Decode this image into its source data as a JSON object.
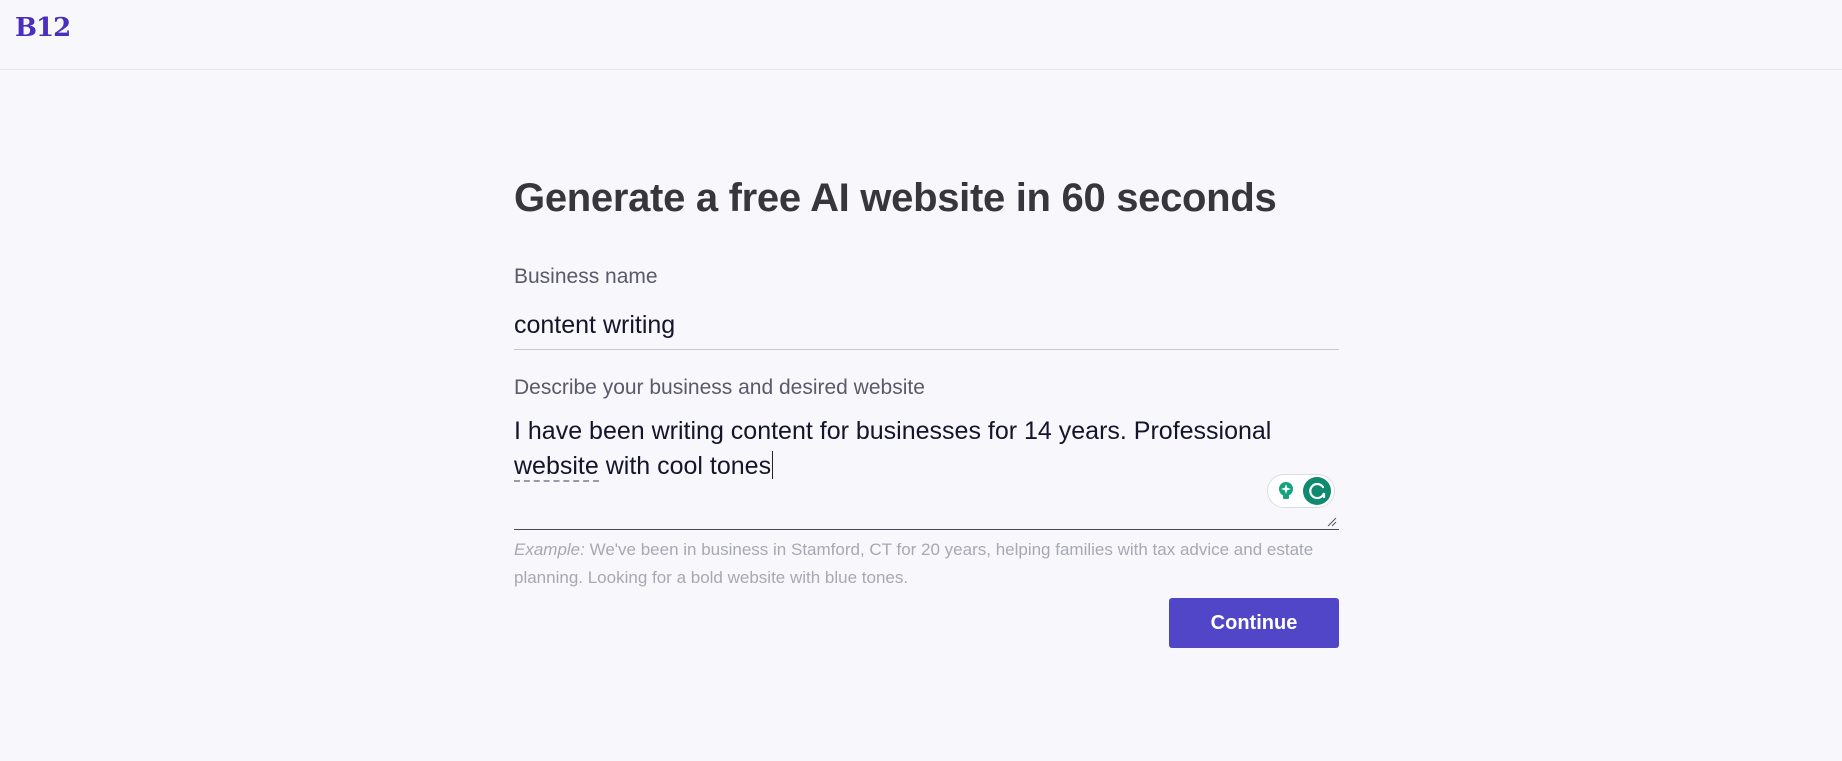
{
  "header": {
    "logo_text": "B12"
  },
  "form": {
    "title": "Generate a free AI website in 60 seconds",
    "business_name_label": "Business name",
    "business_name_value": "content writing",
    "description_label": "Describe your business and desired website",
    "description_value_before": "I have been writing content for businesses for 14 years. Professional\n",
    "description_value_flagged_word": "website",
    "description_value_after": " with cool tones",
    "hint_prefix": "Example:",
    "hint_text": " We've been in business in Stamford, CT for 20 years, helping families with tax advice and estate planning. Looking for a bold website with blue tones.",
    "continue_label": "Continue"
  },
  "colors": {
    "brand": "#4a2fbd",
    "button": "#5246c8",
    "background": "#f7f7fc",
    "assistant_green": "#0f8a6e"
  },
  "icons": {
    "assistant_bulb": "lightbulb-sparkle-icon",
    "assistant_logo": "writing-assistant-icon",
    "resize": "resize-handle-icon"
  }
}
